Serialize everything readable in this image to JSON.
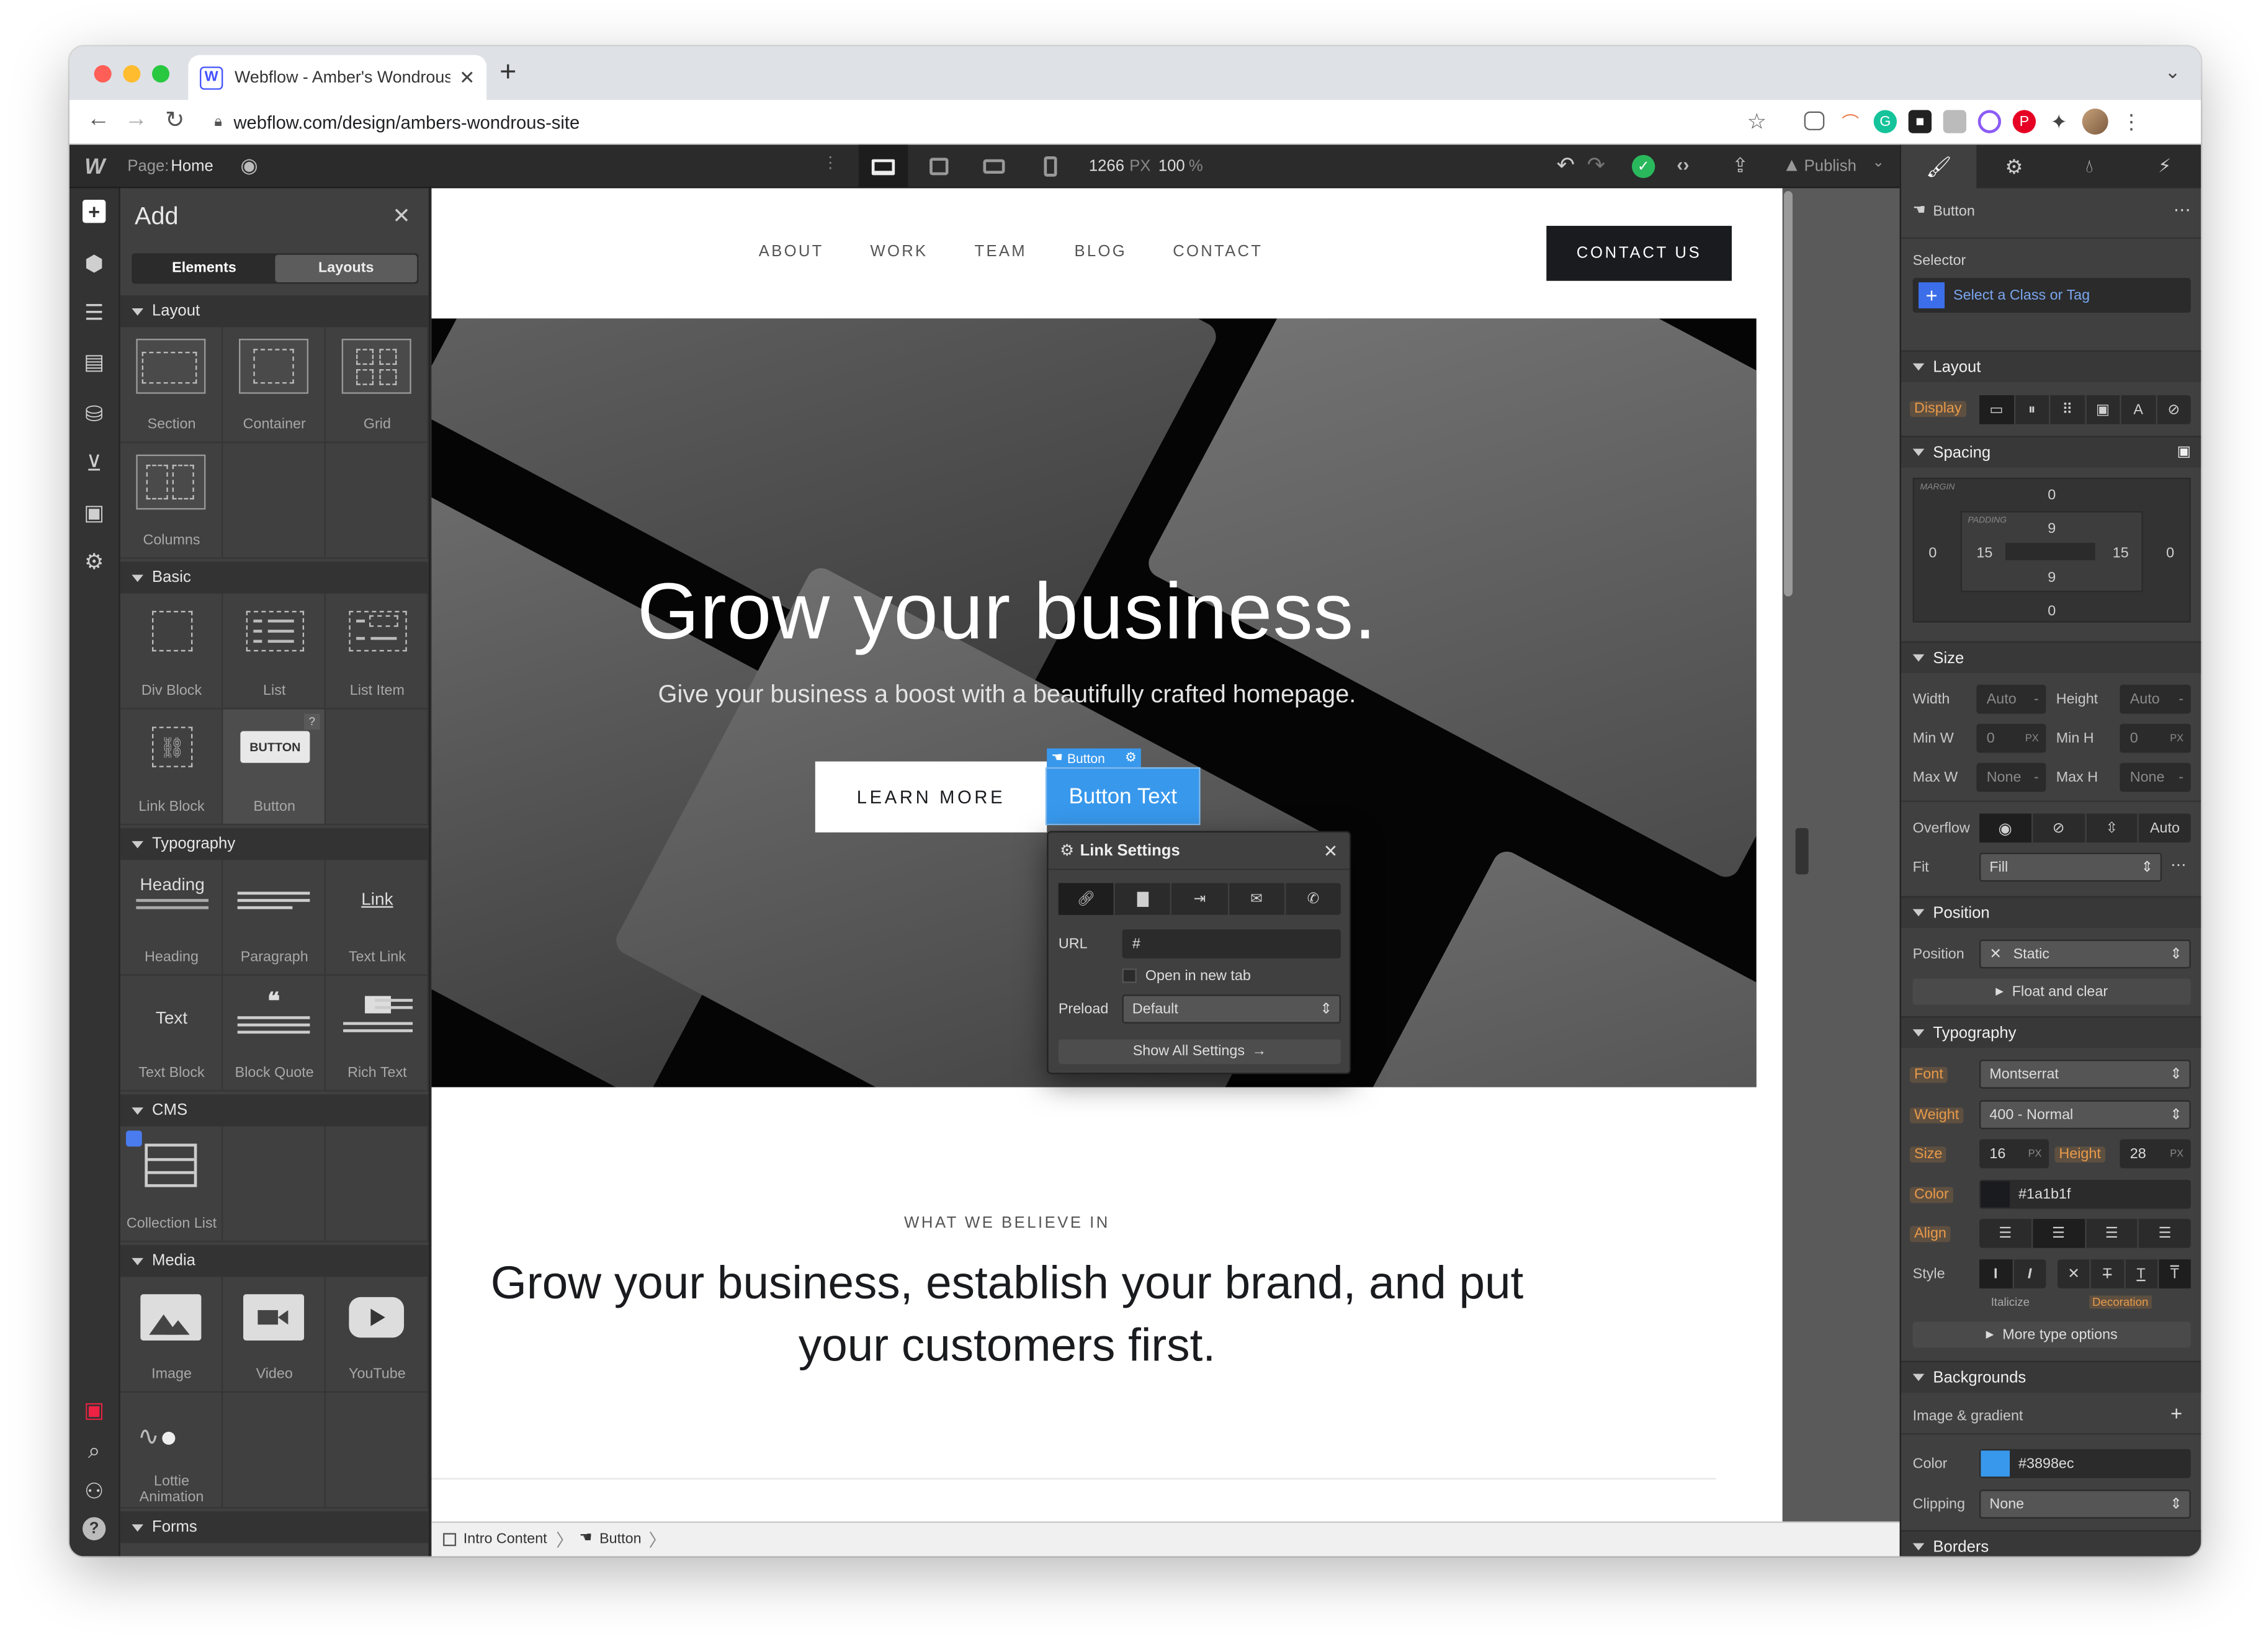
{
  "browser": {
    "tab_title": "Webflow - Amber's Wondrous",
    "url": "webflow.com/design/ambers-wondrous-site",
    "new_tab": "+",
    "favicon_letter": "W"
  },
  "topbar": {
    "page_label": "Page:",
    "page_name": "Home",
    "width_value": "1266",
    "width_unit": "PX",
    "zoom": "100",
    "zoom_unit": "%",
    "publish": "Publish"
  },
  "add_panel": {
    "title": "Add",
    "tab_elements": "Elements",
    "tab_layouts": "Layouts",
    "sections": {
      "layout": "Layout",
      "basic": "Basic",
      "typography": "Typography",
      "cms": "CMS",
      "media": "Media",
      "forms": "Forms"
    },
    "items": {
      "section": "Section",
      "container": "Container",
      "grid": "Grid",
      "columns": "Columns",
      "div_block": "Div Block",
      "list": "List",
      "list_item": "List Item",
      "link_block": "Link Block",
      "button": "Button",
      "button_icon_text": "BUTTON",
      "help": "?",
      "heading": "Heading",
      "heading_icon_text": "Heading",
      "paragraph": "Paragraph",
      "text_link": "Text Link",
      "text_link_icon_text": "Link",
      "text_block": "Text Block",
      "text_block_icon_text": "Text",
      "block_quote": "Block Quote",
      "rich_text": "Rich Text",
      "collection_list": "Collection List",
      "image": "Image",
      "video": "Video",
      "youtube": "YouTube",
      "lottie": "Lottie Animation"
    }
  },
  "site": {
    "nav": [
      "ABOUT",
      "WORK",
      "TEAM",
      "BLOG",
      "CONTACT"
    ],
    "contact_button": "CONTACT US",
    "hero_title": "Grow your business.",
    "hero_subtitle": "Give your business a boost with a beautifully crafted homepage.",
    "learn_more": "LEARN MORE",
    "selected_tag": "Button",
    "button_text": "Button Text",
    "eyebrow": "WHAT WE BELIEVE IN",
    "statement": "Grow your business, establish your brand, and put your customers first."
  },
  "link_settings": {
    "title": "Link Settings",
    "url_label": "URL",
    "url_value": "#",
    "new_tab_label": "Open in new tab",
    "preload_label": "Preload",
    "preload_value": "Default",
    "show_all": "Show All Settings"
  },
  "breadcrumb": [
    "Intro Content",
    "Button"
  ],
  "style_panel": {
    "element_name": "Button",
    "selector_label": "Selector",
    "selector_placeholder": "Select a Class or Tag",
    "layout": "Layout",
    "display_label": "Display",
    "spacing": "Spacing",
    "margin_label": "MARGIN",
    "padding_label": "PADDING",
    "margin": {
      "top": "0",
      "right": "0",
      "bottom": "0",
      "left": "0"
    },
    "padding": {
      "top": "9",
      "right": "15",
      "bottom": "9",
      "left": "15"
    },
    "size": "Size",
    "width_label": "Width",
    "width_val": "Auto",
    "height_label": "Height",
    "height_val": "Auto",
    "minw_label": "Min W",
    "minw_val": "0",
    "minh_label": "Min H",
    "minh_val": "0",
    "maxw_label": "Max W",
    "maxw_val": "None",
    "maxh_label": "Max H",
    "maxh_val": "None",
    "unit_px": "PX",
    "unit_dash": "-",
    "overflow_label": "Overflow",
    "overflow_auto": "Auto",
    "fit_label": "Fit",
    "fit_val": "Fill",
    "position": "Position",
    "position_label": "Position",
    "position_val": "Static",
    "float_clear": "Float and clear",
    "typography": "Typography",
    "font_label": "Font",
    "font_val": "Montserrat",
    "weight_label": "Weight",
    "weight_val": "400 - Normal",
    "size_label": "Size",
    "size_val": "16",
    "lh_label": "Height",
    "lh_val": "28",
    "color_label": "Color",
    "color_val": "#1a1b1f",
    "align_label": "Align",
    "style_label": "Style",
    "italicize": "Italicize",
    "decoration": "Decoration",
    "more_type": "More type options",
    "backgrounds": "Backgrounds",
    "image_gradient": "Image & gradient",
    "bg_color_label": "Color",
    "bg_color_val": "#3898ec",
    "clipping_label": "Clipping",
    "clipping_val": "None",
    "borders": "Borders"
  },
  "colors": {
    "accent_blue": "#3898ec",
    "text_dark": "#1a1b1f",
    "webflow_blue": "#4353ff",
    "publish_green": "#2ab85c"
  }
}
